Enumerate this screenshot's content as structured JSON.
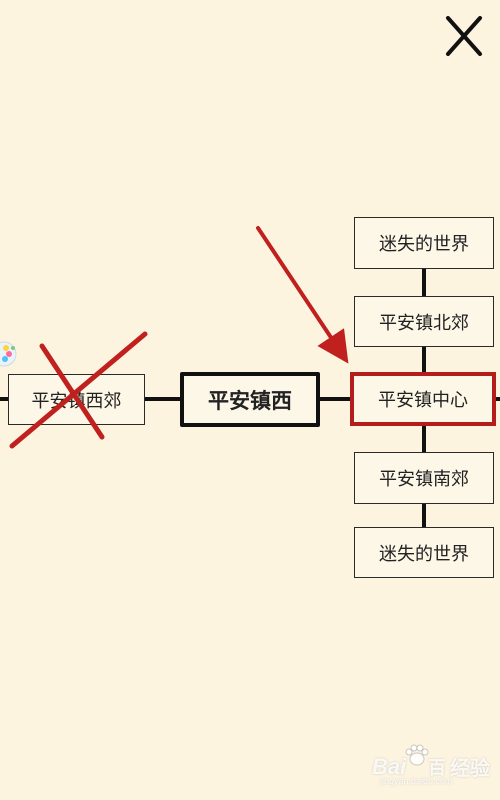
{
  "close_button": {
    "icon": "close-icon"
  },
  "map": {
    "current": {
      "label": "平安镇西"
    },
    "left": {
      "label": "平安镇西郊"
    },
    "right_column": [
      {
        "label": "迷失的世界"
      },
      {
        "label": "平安镇北郊"
      },
      {
        "label": "平安镇中心"
      },
      {
        "label": "平安镇南郊"
      },
      {
        "label": "迷失的世界"
      }
    ]
  },
  "annotations": {
    "color": "#c0201e",
    "highlight": "平安镇中心",
    "crossed_out": "平安镇西郊"
  },
  "watermark": {
    "brand": "Bai",
    "brand_suffix": "百",
    "site": "jingyan.baidu.com",
    "label": "经验"
  }
}
